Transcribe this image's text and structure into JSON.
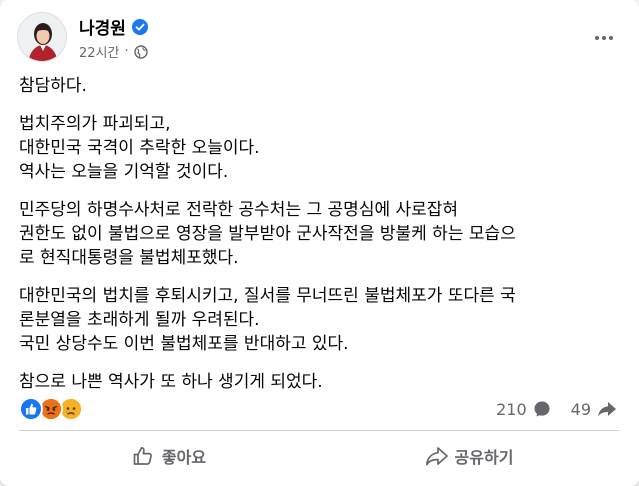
{
  "post": {
    "author": "나경원",
    "time": "22시간",
    "body": [
      [
        "참담하다."
      ],
      [
        "법치주의가 파괴되고,",
        "대한민국 국격이 추락한 오늘이다.",
        "역사는 오늘을 기억할 것이다."
      ],
      [
        "민주당의 하명수사처로 전락한 공수처는 그 공명심에 사로잡혀",
        "권한도 없이 불법으로 영장을 발부받아 군사작전을 방불케 하는 모습으",
        "로 현직대통령을 불법체포했다."
      ],
      [
        "대한민국의 법치를 후퇴시키고, 질서를 무너뜨린 불법체포가 또다른 국",
        "론분열을 초래하게 될까 우려된다.",
        "국민 상당수도 이번 불법체포를 반대하고 있다."
      ],
      [
        "참으로 나쁜 역사가 또 하나 생기게 되었다."
      ]
    ]
  },
  "engagement": {
    "reactions": [
      "like",
      "angry",
      "sad"
    ],
    "comments": "210",
    "shares": "49"
  },
  "actions": {
    "like_label": "좋아요",
    "share_label": "공유하기"
  },
  "colors": {
    "like": "#1877f2",
    "angry": "#e9710f",
    "sad": "#f7b125",
    "secondary_text": "#65676b"
  }
}
